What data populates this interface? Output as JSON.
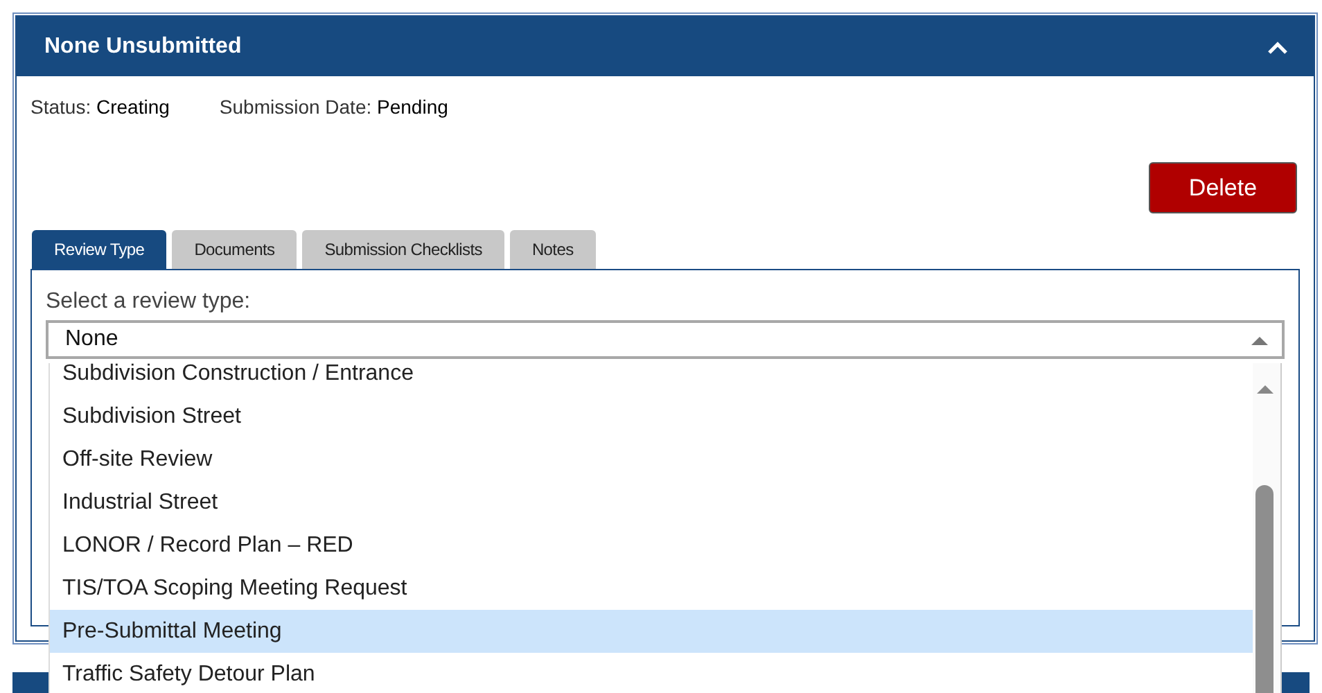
{
  "panel": {
    "title": "None Unsubmitted",
    "expanded": true
  },
  "status": {
    "label": "Status:",
    "value": "Creating"
  },
  "submission_date": {
    "label": "Submission Date:",
    "value": "Pending"
  },
  "delete_button": "Delete",
  "tabs": [
    {
      "label": "Review Type",
      "selected": true
    },
    {
      "label": "Documents",
      "selected": false
    },
    {
      "label": "Submission Checklists",
      "selected": false
    },
    {
      "label": "Notes",
      "selected": false
    }
  ],
  "review_type": {
    "label": "Select a review type:",
    "value": "None",
    "expanded": true,
    "options": [
      {
        "label": "Subdivision Construction / Entrance",
        "selected": false
      },
      {
        "label": "Subdivision Street",
        "selected": false
      },
      {
        "label": "Off-site Review",
        "selected": false
      },
      {
        "label": "Industrial Street",
        "selected": false
      },
      {
        "label": "LONOR / Record Plan – RED",
        "selected": false
      },
      {
        "label": "TIS/TOA Scoping Meeting Request",
        "selected": false
      },
      {
        "label": "Pre-Submittal Meeting",
        "selected": true
      },
      {
        "label": "Traffic Safety Detour Plan",
        "selected": false
      }
    ]
  }
}
